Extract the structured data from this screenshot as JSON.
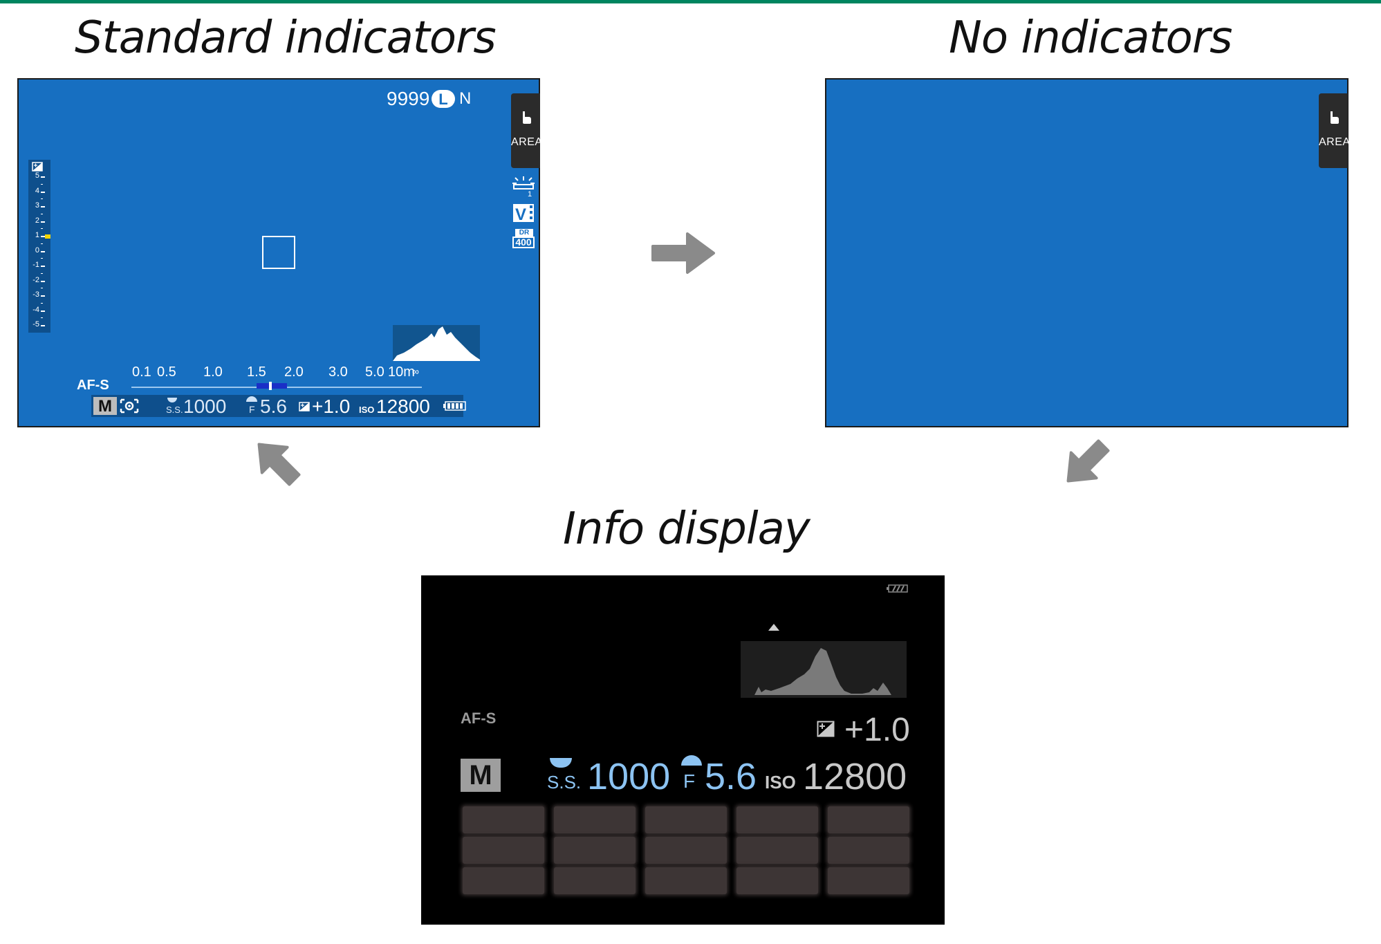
{
  "titles": {
    "standard": "Standard indicators",
    "none": "No indicators",
    "info": "Info display"
  },
  "colors": {
    "screen_blue": "#176fc1",
    "arrow_grey": "#8a8a8a",
    "accent_green": "#00855f",
    "info_blue_text": "#8cc3f2"
  },
  "standard_screen": {
    "frames_remaining": "9999",
    "image_size": "L",
    "image_quality": "N",
    "area_label": "AREA",
    "dr_label": "DR",
    "dr_value": "400",
    "film_sim": "V",
    "exposure_scale": [
      "5",
      "4",
      "3",
      "2",
      "1",
      "0",
      "-1",
      "-2",
      "-3",
      "-4",
      "-5"
    ],
    "exposure_level": 1,
    "focus_mode": "AF-S",
    "distance_scale": [
      "0.1",
      "0.5",
      "1.0",
      "1.5",
      "2.0",
      "3.0",
      "5.0",
      "10m",
      "∞"
    ],
    "shooting_mode": "M",
    "ss_label": "S.S.",
    "shutter_speed": "1000",
    "f_label": "F",
    "aperture": "5.6",
    "exposure_comp": "+1.0",
    "iso_label": "ISO",
    "iso": "12800",
    "icons": [
      "area-hand-icon",
      "self-timer-icon",
      "film-simulation-icon",
      "dynamic-range-icon",
      "metering-icon",
      "exposure-comp-icon",
      "battery-icon",
      "histogram"
    ]
  },
  "none_screen": {
    "area_label": "AREA"
  },
  "info_screen": {
    "focus_mode": "AF-S",
    "exposure_comp": "+1.0",
    "shooting_mode": "M",
    "ss_label": "S.S.",
    "shutter_speed": "1000",
    "f_label": "F",
    "aperture": "5.6",
    "iso_label": "ISO",
    "iso": "12800",
    "function_grid": {
      "rows": 3,
      "cols": 5
    }
  },
  "flow": [
    "standard-to-none",
    "none-to-info",
    "info-to-standard"
  ]
}
